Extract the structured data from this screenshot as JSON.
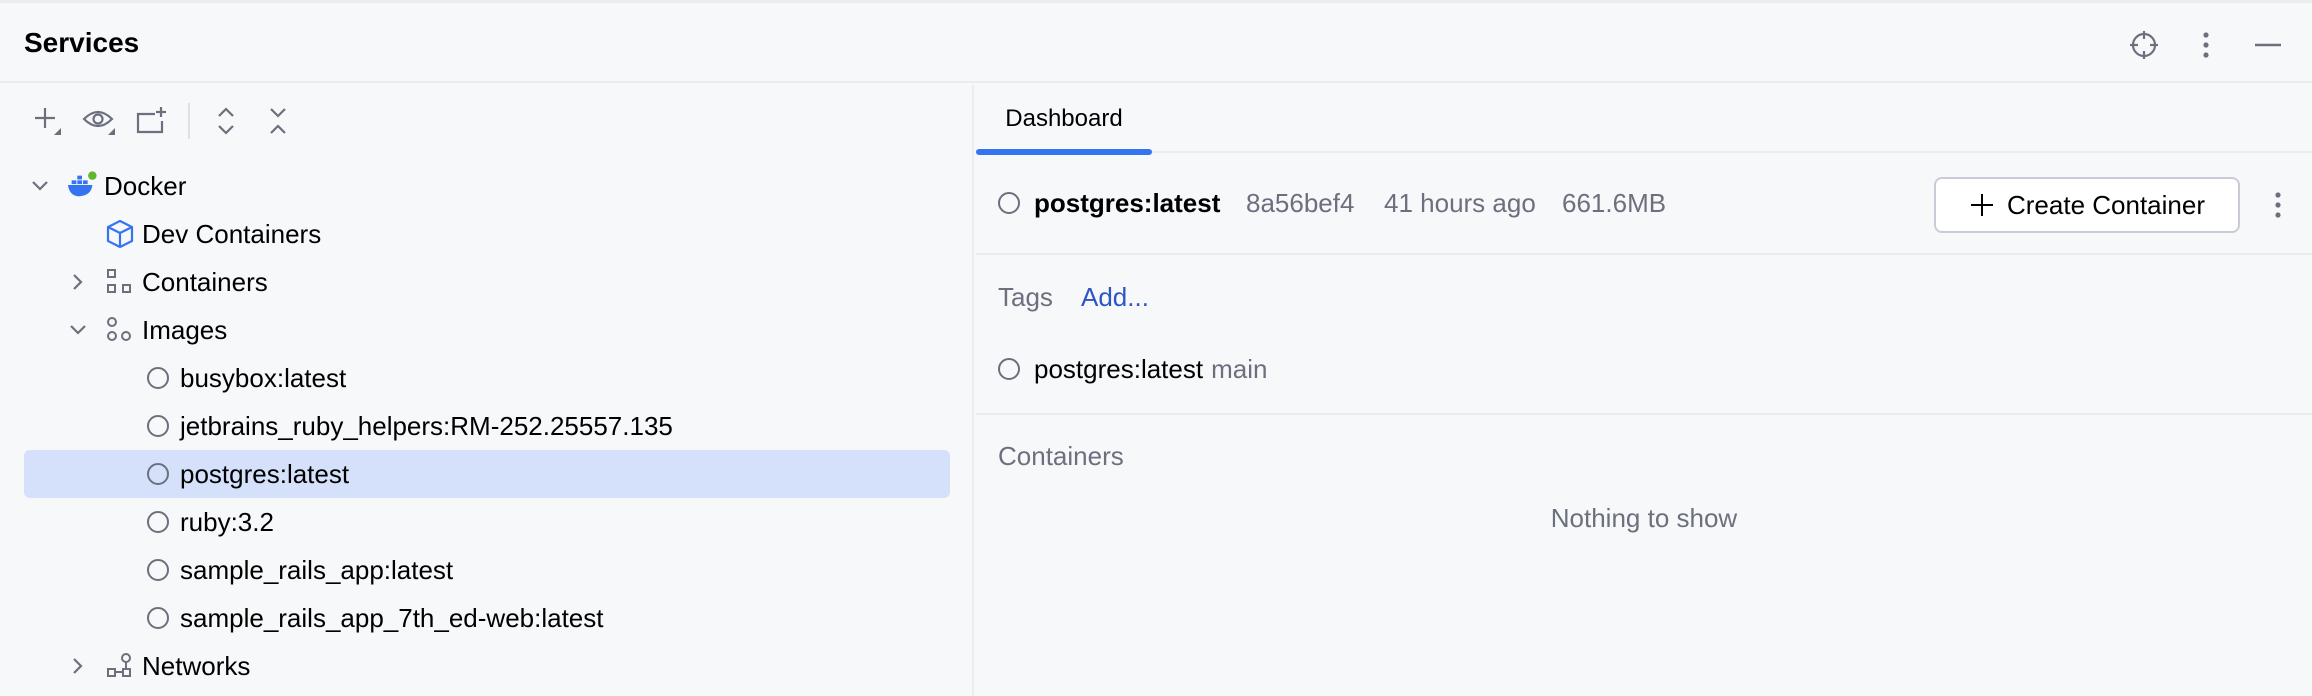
{
  "panel": {
    "title": "Services"
  },
  "tree": {
    "items": [
      {
        "label": "Docker",
        "level": 0,
        "expanded": true
      },
      {
        "label": "Dev Containers",
        "level": 1
      },
      {
        "label": "Containers",
        "level": 1,
        "expanded": false
      },
      {
        "label": "Images",
        "level": 1,
        "expanded": true
      },
      {
        "label": "busybox:latest",
        "level": 2
      },
      {
        "label": "jetbrains_ruby_helpers:RM-252.25557.135",
        "level": 2
      },
      {
        "label": "postgres:latest",
        "level": 2,
        "selected": true
      },
      {
        "label": "ruby:3.2",
        "level": 2
      },
      {
        "label": "sample_rails_app:latest",
        "level": 2
      },
      {
        "label": "sample_rails_app_7th_ed-web:latest",
        "level": 2
      },
      {
        "label": "Networks",
        "level": 1,
        "expanded": false
      }
    ]
  },
  "dashboard": {
    "tab_label": "Dashboard",
    "image": {
      "name": "postgres:latest",
      "id": "8a56bef4",
      "created": "41 hours ago",
      "size": "661.6MB"
    },
    "create_button": "Create Container",
    "tags": {
      "label": "Tags",
      "add_link": "Add...",
      "items": [
        {
          "name": "postgres:latest",
          "branch": "main"
        }
      ]
    },
    "containers": {
      "label": "Containers",
      "empty_text": "Nothing to show"
    }
  },
  "colors": {
    "accent": "#3574f0",
    "selection": "#d5e1fb",
    "link": "#2e55c6",
    "muted_text": "#6c707e"
  }
}
